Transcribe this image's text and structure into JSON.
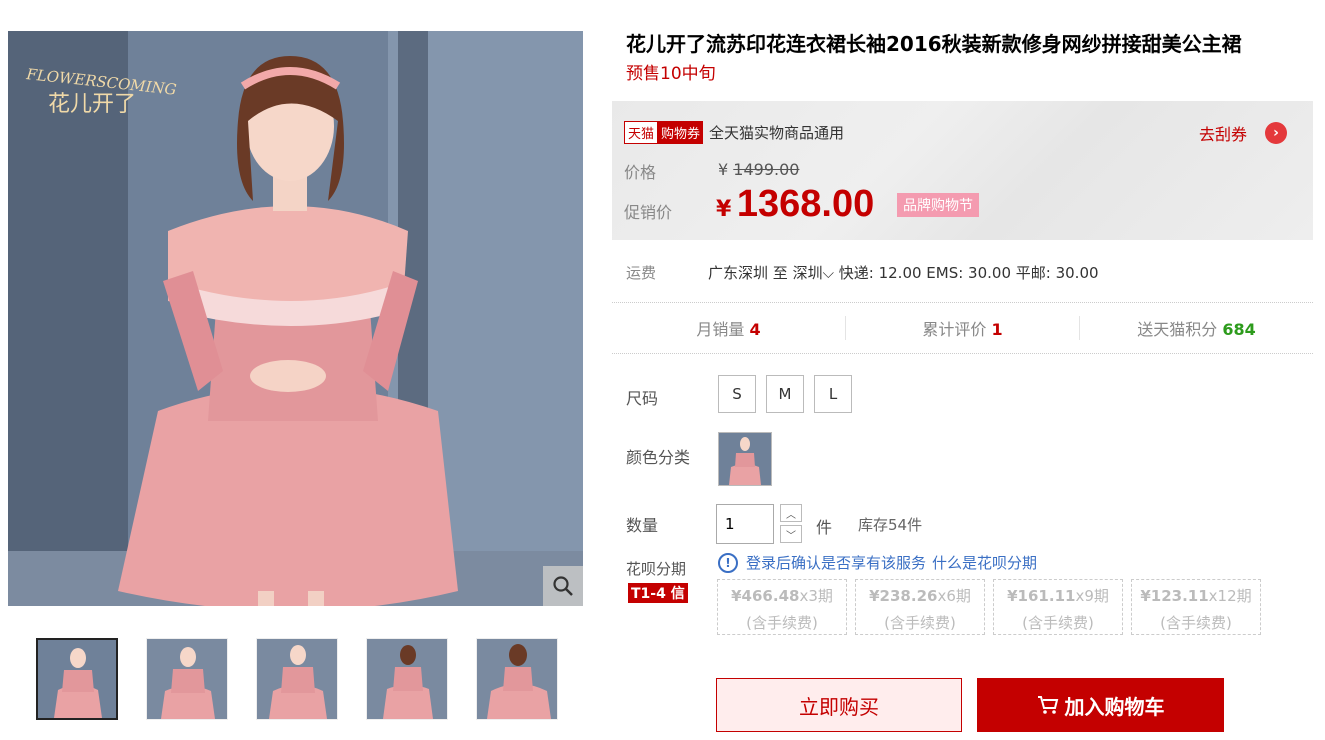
{
  "product": {
    "title": "花儿开了流苏印花连衣裙长袖2016秋装新款修身网纱拼接甜美公主裙",
    "subtitle": "预售10中旬",
    "watermark_latin": "FLOWERSCOMING",
    "watermark_cn": "花儿开了"
  },
  "coupon": {
    "tag_tmall": "天猫",
    "tag_coupon": "购物券",
    "text": "全天猫实物商品通用",
    "scratch_label": "去刮券",
    "scratch_icon": "arrow-right-circle-icon"
  },
  "price": {
    "label": "价格",
    "currency": "¥",
    "original": "1499.00",
    "promo_label": "促销价",
    "promo": "1368.00",
    "promo_badge": "品牌购物节"
  },
  "shipping": {
    "label": "运费",
    "from": "广东深圳",
    "to_prefix": "至",
    "to": "深圳",
    "rates": "快递: 12.00 EMS: 30.00 平邮: 30.00"
  },
  "stats": [
    {
      "label": "月销量",
      "value": "4",
      "color": "red"
    },
    {
      "label": "累计评价",
      "value": "1",
      "color": "red"
    },
    {
      "label": "送天猫积分",
      "value": "684",
      "color": "green"
    }
  ],
  "options": {
    "size_label": "尺码",
    "sizes": [
      "S",
      "M",
      "L"
    ],
    "color_label": "颜色分类",
    "qty_label": "数量",
    "qty_value": "1",
    "qty_unit": "件",
    "stock": "库存54件"
  },
  "huabei": {
    "label": "花呗分期",
    "badge": "T1-4 信",
    "tip": "登录后确认是否享有该服务",
    "link": "什么是花呗分期",
    "installments": [
      {
        "amount": "¥466.48",
        "periods": "x3期",
        "fee": "(含手续费)"
      },
      {
        "amount": "¥238.26",
        "periods": "x6期",
        "fee": "(含手续费)"
      },
      {
        "amount": "¥161.11",
        "periods": "x9期",
        "fee": "(含手续费)"
      },
      {
        "amount": "¥123.11",
        "periods": "x12期",
        "fee": "(含手续费)"
      }
    ]
  },
  "actions": {
    "buy_now": "立即购买",
    "add_cart": "加入购物车"
  },
  "colors": {
    "accent": "#c40000",
    "green": "#2d9b1c",
    "dress_pink": "#e79a9c",
    "wall_blue": "#6d7f97"
  }
}
